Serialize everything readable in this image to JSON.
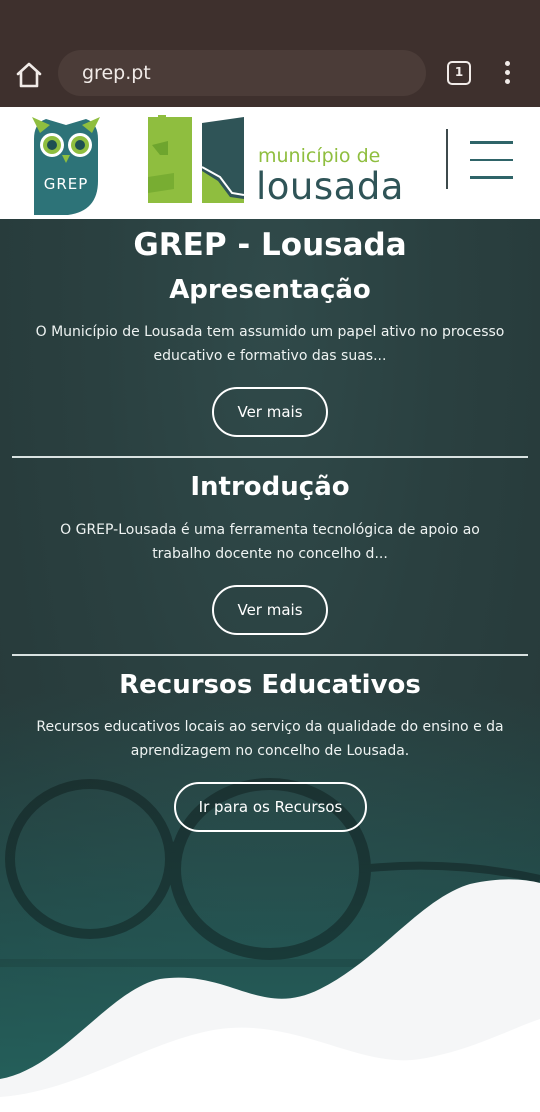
{
  "browser": {
    "url": "grep.pt",
    "tab_count": "1"
  },
  "header": {
    "grep_logo_text": "GREP",
    "municipality_line1": "município de",
    "municipality_line2": "lousada"
  },
  "hero": {
    "site_title": "GREP - Lousada",
    "sections": [
      {
        "title": "Apresentação",
        "text": "O Município de Lousada tem assumido um papel ativo no processo educativo e formativo das suas...",
        "button": "Ver mais"
      },
      {
        "title": "Introdução",
        "text": "O GREP-Lousada é uma ferramenta tecnológica de apoio ao trabalho docente no concelho d...",
        "button": "Ver mais"
      },
      {
        "title": "Recursos Educativos",
        "text": "Recursos educativos locais ao serviço da qualidade do ensino e da aprendizagem no concelho de Lousada.",
        "button": "Ir para os Recursos"
      }
    ]
  },
  "colors": {
    "chrome_bg": "#3e302d",
    "brand_teal": "#2f6468",
    "brand_green": "#8fbe3f",
    "hero_bg": "#2a4040"
  }
}
